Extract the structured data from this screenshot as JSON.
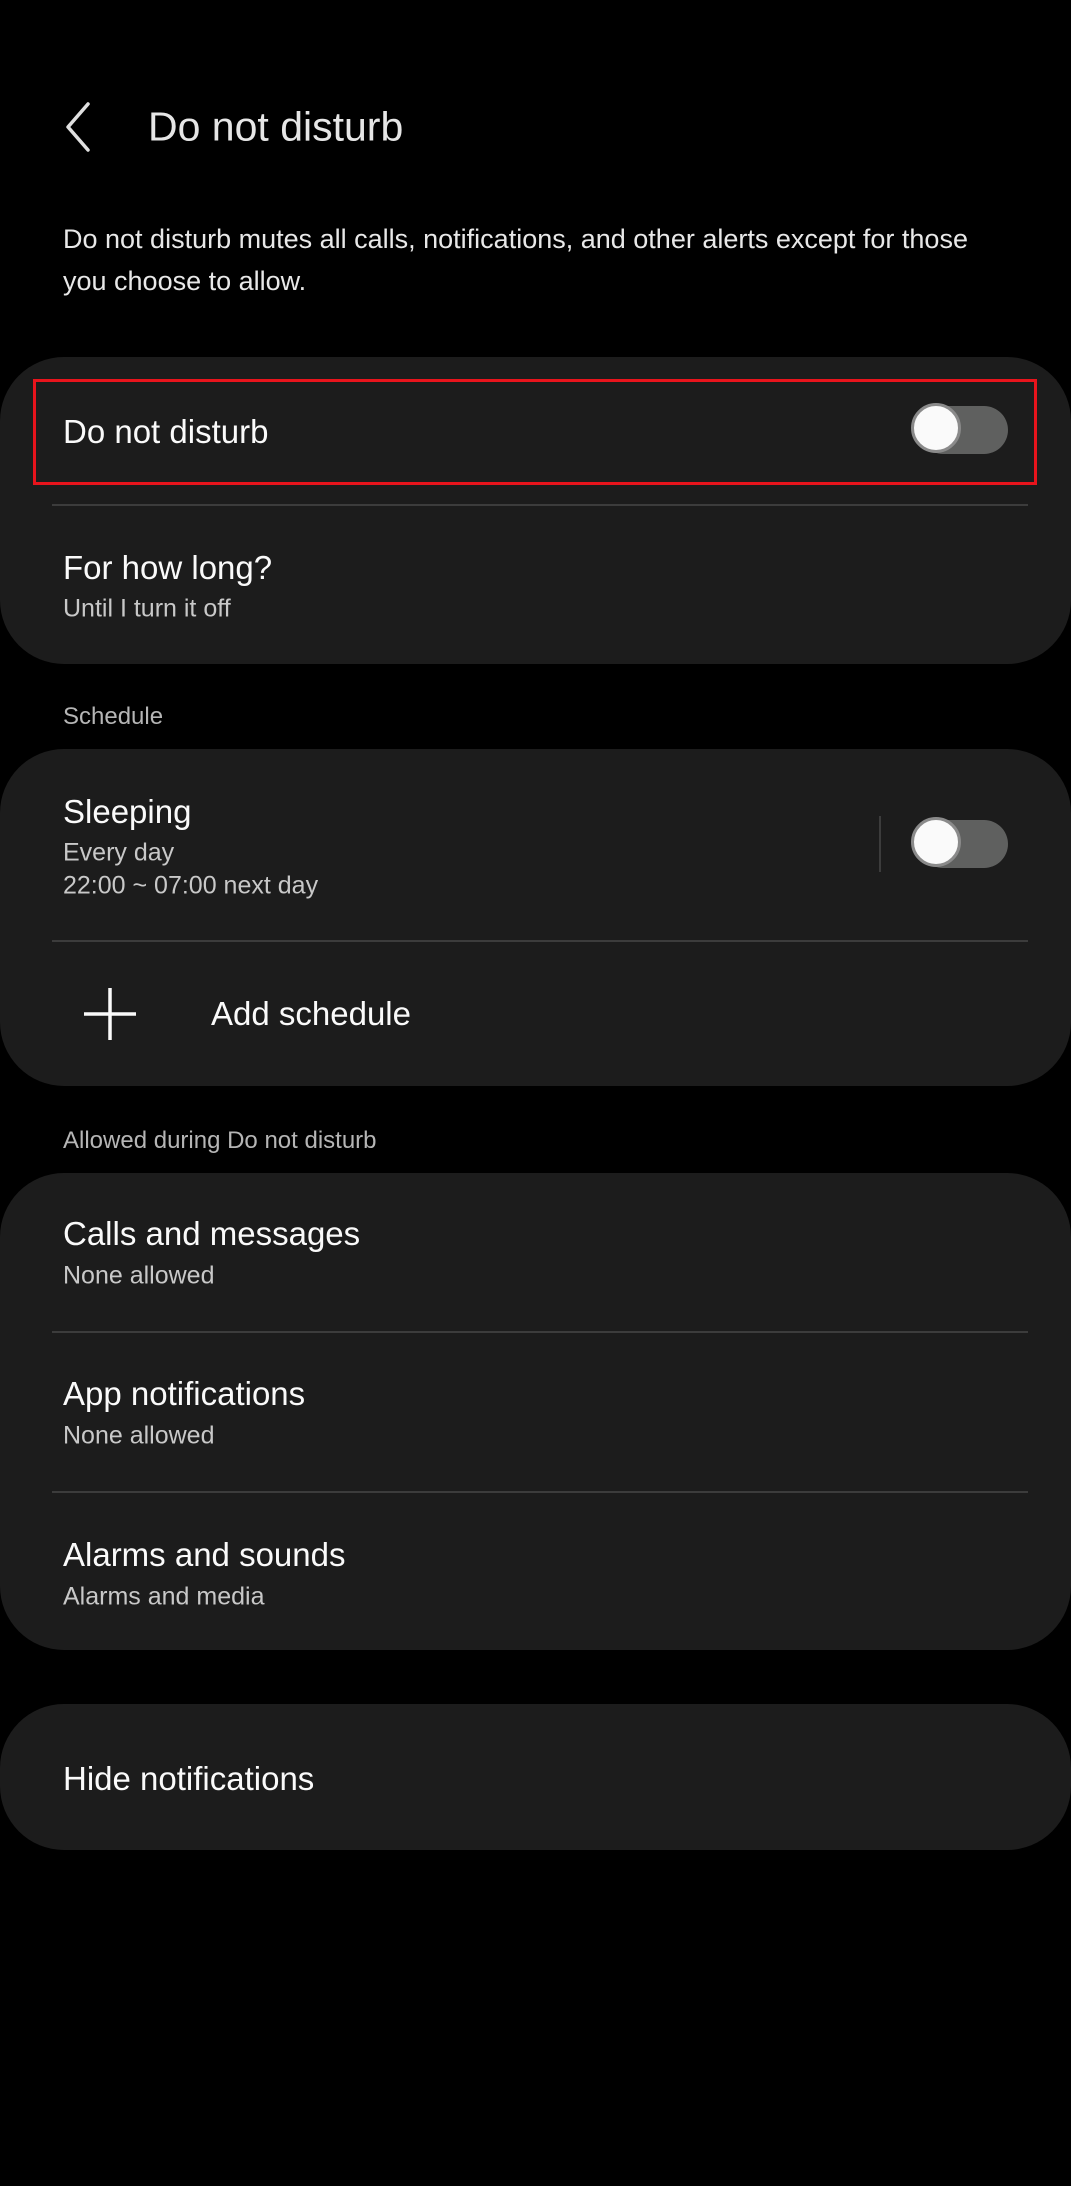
{
  "header": {
    "title": "Do not disturb",
    "back_icon": "chevron-left-icon"
  },
  "description": "Do not disturb mutes all calls, notifications, and other alerts except for those you choose to allow.",
  "main_card": {
    "dnd_toggle": {
      "label": "Do not disturb",
      "on": false,
      "highlight_color": "#e8141c"
    },
    "duration": {
      "title": "For how long?",
      "value": "Until I turn it off"
    }
  },
  "schedule": {
    "header": "Schedule",
    "items": [
      {
        "title": "Sleeping",
        "days": "Every day",
        "time": "22:00 ~ 07:00 next day",
        "on": false
      }
    ],
    "add_label": "Add schedule"
  },
  "allowed": {
    "header": "Allowed during Do not disturb",
    "items": [
      {
        "title": "Calls and messages",
        "value": "None allowed"
      },
      {
        "title": "App notifications",
        "value": "None allowed"
      },
      {
        "title": "Alarms and sounds",
        "value": "Alarms and media"
      }
    ]
  },
  "hide_notifications": {
    "title": "Hide notifications"
  }
}
